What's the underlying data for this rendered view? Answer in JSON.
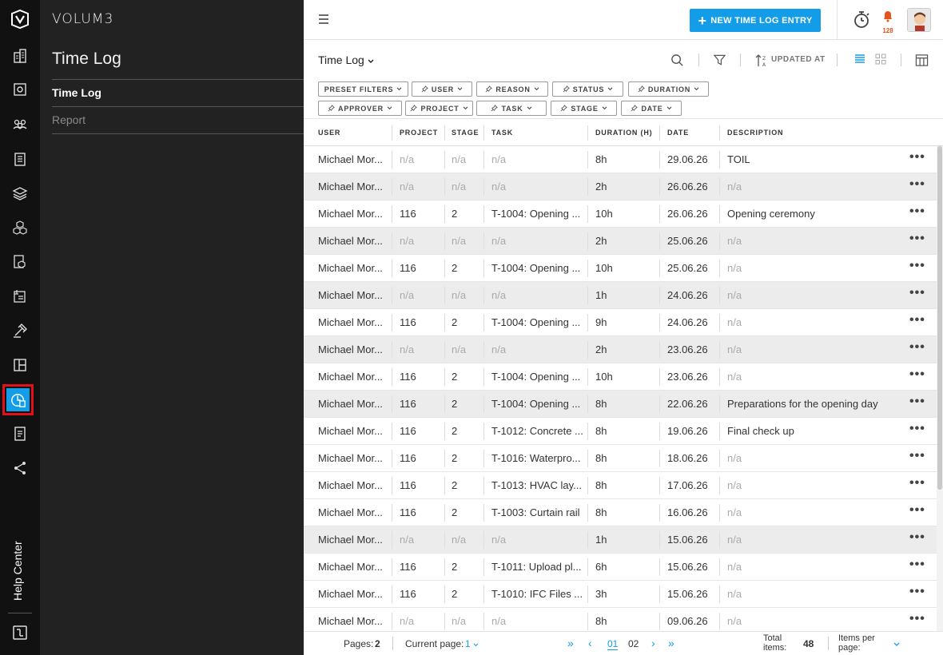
{
  "brand": "VOLUM3",
  "rail": {
    "icons": [
      "logo-icon",
      "buildings-icon",
      "settings-building-icon",
      "team-icon",
      "clipboard-icon",
      "layers-icon",
      "cubes-icon",
      "document-cube-icon",
      "drawing-icon",
      "hammer-icon",
      "layout-icon",
      "time-log-icon",
      "report-book-icon",
      "share-icon"
    ],
    "help_center": "Help Center"
  },
  "panel": {
    "title": "Time Log",
    "items": [
      {
        "label": "Time Log",
        "active": true
      },
      {
        "label": "Report",
        "active": false
      }
    ]
  },
  "topbar": {
    "new_button": "NEW TIME LOG ENTRY",
    "notification_count": "128"
  },
  "toolbar": {
    "view_title": "Time Log",
    "sort_label": "UPDATED AT"
  },
  "filters": [
    {
      "label": "PRESET FILTERS",
      "pin": false
    },
    {
      "label": "USER",
      "pin": true
    },
    {
      "label": "REASON",
      "pin": true
    },
    {
      "label": "STATUS",
      "pin": true
    },
    {
      "label": "DURATION",
      "pin": true
    },
    {
      "label": "APPROVER",
      "pin": true
    },
    {
      "label": "PROJECT",
      "pin": true
    },
    {
      "label": "TASK",
      "pin": true
    },
    {
      "label": "STAGE",
      "pin": true
    },
    {
      "label": "DATE",
      "pin": true
    }
  ],
  "table": {
    "columns": [
      "USER",
      "PROJECT",
      "STAGE",
      "TASK",
      "DURATION (H)",
      "DATE",
      "DESCRIPTION"
    ],
    "rows": [
      [
        "Michael Mor...",
        "n/a",
        "n/a",
        "n/a",
        "8h",
        "29.06.26",
        "TOIL"
      ],
      [
        "Michael Mor...",
        "n/a",
        "n/a",
        "n/a",
        "2h",
        "26.06.26",
        "n/a"
      ],
      [
        "Michael Mor...",
        "116",
        "2",
        "T-1004: Opening ...",
        "10h",
        "26.06.26",
        "Opening ceremony"
      ],
      [
        "Michael Mor...",
        "n/a",
        "n/a",
        "n/a",
        "2h",
        "25.06.26",
        "n/a"
      ],
      [
        "Michael Mor...",
        "116",
        "2",
        "T-1004: Opening ...",
        "10h",
        "25.06.26",
        "n/a"
      ],
      [
        "Michael Mor...",
        "n/a",
        "n/a",
        "n/a",
        "1h",
        "24.06.26",
        "n/a"
      ],
      [
        "Michael Mor...",
        "116",
        "2",
        "T-1004: Opening ...",
        "9h",
        "24.06.26",
        "n/a"
      ],
      [
        "Michael Mor...",
        "n/a",
        "n/a",
        "n/a",
        "2h",
        "23.06.26",
        "n/a"
      ],
      [
        "Michael Mor...",
        "116",
        "2",
        "T-1004: Opening ...",
        "10h",
        "23.06.26",
        "n/a"
      ],
      [
        "Michael Mor...",
        "116",
        "2",
        "T-1004: Opening ...",
        "8h",
        "22.06.26",
        "Preparations for the opening day"
      ],
      [
        "Michael Mor...",
        "116",
        "2",
        "T-1012: Concrete ...",
        "8h",
        "19.06.26",
        "Final check up"
      ],
      [
        "Michael Mor...",
        "116",
        "2",
        "T-1016: Waterpro...",
        "8h",
        "18.06.26",
        "n/a"
      ],
      [
        "Michael Mor...",
        "116",
        "2",
        "T-1013: HVAC lay...",
        "8h",
        "17.06.26",
        "n/a"
      ],
      [
        "Michael Mor...",
        "116",
        "2",
        "T-1003: Curtain rail",
        "8h",
        "16.06.26",
        "n/a"
      ],
      [
        "Michael Mor...",
        "n/a",
        "n/a",
        "n/a",
        "1h",
        "15.06.26",
        "n/a"
      ],
      [
        "Michael Mor...",
        "116",
        "2",
        "T-1011: Upload pl...",
        "6h",
        "15.06.26",
        "n/a"
      ],
      [
        "Michael Mor...",
        "116",
        "2",
        "T-1010: IFC Files ...",
        "3h",
        "15.06.26",
        "n/a"
      ],
      [
        "Michael Mor...",
        "n/a",
        "n/a",
        "n/a",
        "8h",
        "09.06.26",
        "n/a"
      ]
    ],
    "alt_rows": [
      1,
      3,
      5,
      7,
      9,
      14
    ]
  },
  "footer": {
    "pages_label": "Pages:",
    "pages_value": "2",
    "current_label": "Current page:",
    "current_value": "1",
    "page_numbers": [
      "01",
      "02"
    ],
    "total_label_1": "Total",
    "total_label_2": "items:",
    "total_value": "48",
    "per_page_1": "Items per",
    "per_page_2": "page:"
  }
}
